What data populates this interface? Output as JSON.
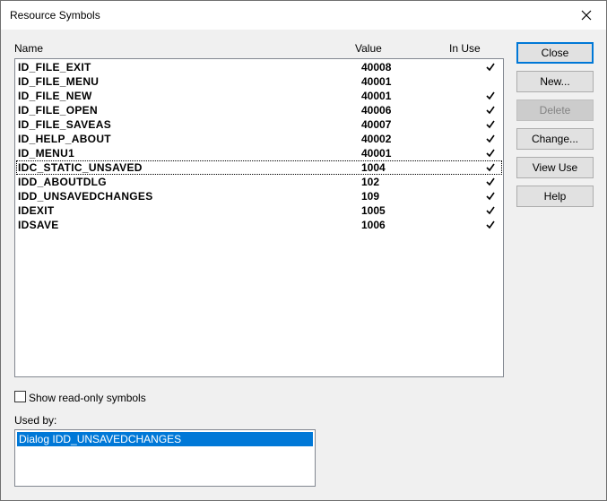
{
  "window": {
    "title": "Resource Symbols"
  },
  "columns": {
    "name": "Name",
    "value": "Value",
    "in_use": "In Use"
  },
  "symbols": [
    {
      "name": "ID_FILE_EXIT",
      "value": "40008",
      "in_use": true
    },
    {
      "name": "ID_FILE_MENU",
      "value": "40001",
      "in_use": false
    },
    {
      "name": "ID_FILE_NEW",
      "value": "40001",
      "in_use": true
    },
    {
      "name": "ID_FILE_OPEN",
      "value": "40006",
      "in_use": true
    },
    {
      "name": "ID_FILE_SAVEAS",
      "value": "40007",
      "in_use": true
    },
    {
      "name": "ID_HELP_ABOUT",
      "value": "40002",
      "in_use": true
    },
    {
      "name": "ID_MENU1",
      "value": "40001",
      "in_use": true
    },
    {
      "name": "IDC_STATIC_UNSAVED",
      "value": "1004",
      "in_use": true
    },
    {
      "name": "IDD_ABOUTDLG",
      "value": "102",
      "in_use": true
    },
    {
      "name": "IDD_UNSAVEDCHANGES",
      "value": "109",
      "in_use": true
    },
    {
      "name": "IDEXIT",
      "value": "1005",
      "in_use": true
    },
    {
      "name": "IDSAVE",
      "value": "1006",
      "in_use": true
    }
  ],
  "buttons": {
    "close": "Close",
    "new": "New...",
    "delete": "Delete",
    "change": "Change...",
    "view_use": "View Use",
    "help": "Help"
  },
  "options": {
    "show_readonly_label": "Show read-only symbols",
    "show_readonly_checked": false
  },
  "used_by": {
    "label": "Used by:",
    "items": [
      "Dialog IDD_UNSAVEDCHANGES"
    ]
  },
  "colors": {
    "selection": "#0078d7",
    "default_button_border": "#0078d7"
  }
}
